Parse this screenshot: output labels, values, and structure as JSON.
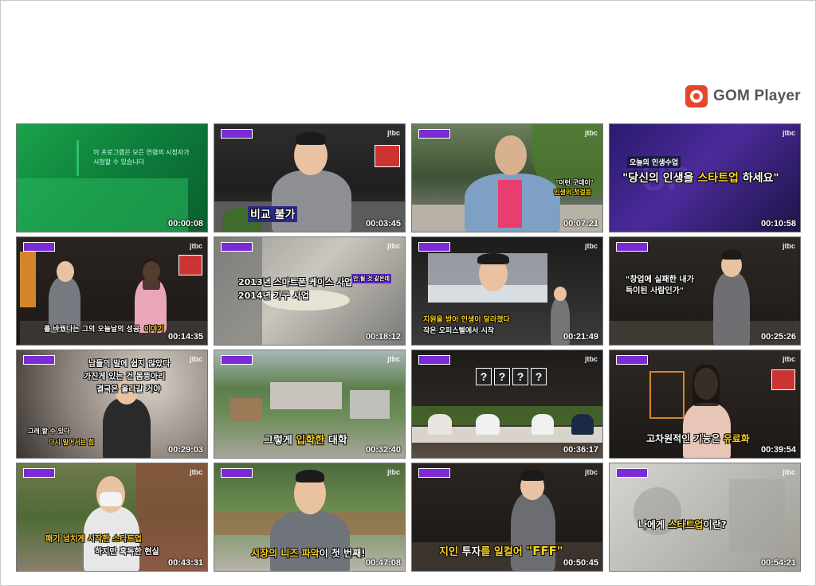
{
  "logo": {
    "icon": "gom-logo-icon",
    "text": "GOM Player"
  },
  "channel": "jtbc",
  "thumbnails": [
    {
      "time": "00:00:08",
      "captions": [
        "이 프로그램은 모든 연령의 시청자가",
        "시청할 수 있습니다"
      ]
    },
    {
      "time": "00:03:45",
      "captions": [
        "비교 불가"
      ]
    },
    {
      "time": "00:07:21",
      "captions": [
        "\"이런 굿데이\"",
        "인생의 첫걸음"
      ]
    },
    {
      "time": "00:10:58",
      "captions": [
        "오늘의 인생수업",
        "\"당신의 인생을 ",
        "스타트업",
        " 하세요\""
      ]
    },
    {
      "time": "00:14:35",
      "captions": [
        "를 바꿨다는 그의 오늘날의 성공",
        "이야기"
      ]
    },
    {
      "time": "00:18:12",
      "captions": [
        "2013년 스마트폰 케이스 사업",
        "2014년 가구 사업",
        "안 될 것 같은데"
      ]
    },
    {
      "time": "00:21:49",
      "captions": [
        "지원을 받아 인생이 달라졌다",
        "작은 오피스텔에서 시작"
      ]
    },
    {
      "time": "00:25:26",
      "captions": [
        "\"창업에 실패한 내가",
        "득이된 사람인가\""
      ]
    },
    {
      "time": "00:29:03",
      "captions": [
        "남들의 말에 쉽지 않았다",
        "가진게 있는 건 몸뚱아리",
        "결국은 올라갈 거야",
        "그래 할 수 있다",
        "다시 일어서는 힘"
      ]
    },
    {
      "time": "00:32:40",
      "captions": [
        "그렇게 ",
        "입학한",
        " 대학"
      ]
    },
    {
      "time": "00:36:17",
      "captions": [
        "?",
        "?",
        "?",
        "?"
      ]
    },
    {
      "time": "00:39:54",
      "captions": [
        "고차원적인 기능",
        "은 ",
        "유료화"
      ]
    },
    {
      "time": "00:43:31",
      "captions": [
        "패기 넘치게 시작한 스타트업",
        "하지만 혹독한 현실"
      ]
    },
    {
      "time": "00:47:08",
      "captions": [
        "시장의 ",
        "니즈 파악",
        "이 첫 번째!"
      ]
    },
    {
      "time": "00:50:45",
      "captions": [
        "지인 ",
        "투자",
        "를 일컬어 ",
        "\"FFF\""
      ]
    },
    {
      "time": "00:54:21",
      "captions": [
        "나에게 ",
        "스타트업",
        "이란?"
      ]
    }
  ]
}
